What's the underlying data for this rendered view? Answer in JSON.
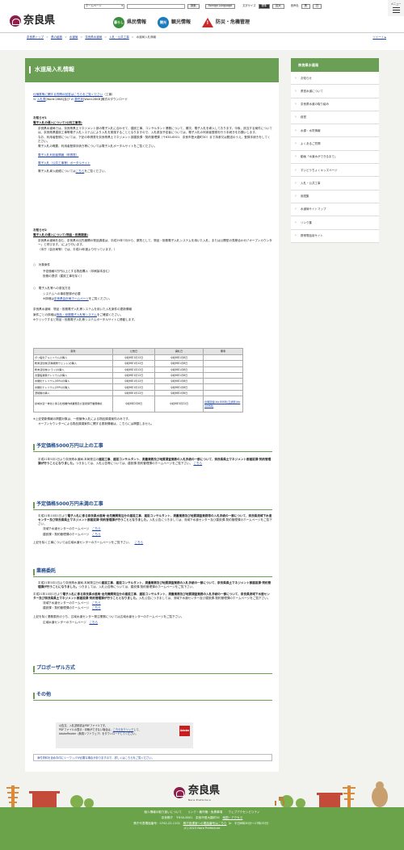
{
  "util": {
    "select": "ホームページ",
    "search": "検索",
    "foreign": "Foreign Language",
    "textsize": "文字サイズ",
    "std": "標準",
    "large": "拡大",
    "voice": "音声色",
    "black": "黒",
    "white": "白",
    "menu": "メニュー"
  },
  "logo": {
    "text": "奈良県"
  },
  "nav": {
    "kurashi": "県民情報",
    "kanko": "観光情報",
    "bosai": "防災・危機管理",
    "kurashi_icon": "暮らし",
    "kanko_icon": "観光"
  },
  "breadcrumbs": [
    "奈良県トップ",
    "県の組織",
    "水道局",
    "奈良県水道局",
    "入札・公共工事",
    "水道局入札情報"
  ],
  "tweet": "ツイート",
  "page": {
    "title": "水道局入札情報"
  },
  "intro": {
    "l1": "仕様書等に関する質問の回答はこちらをご覧ください",
    "l1b": "（工事）",
    "l2a": "入札書",
    "l2b": "[Word:28KB]及び",
    "l2c": "委任状",
    "l2d": "[Word:28KB]様式のダウンロード"
  },
  "notice1": {
    "label": "お知らせ1",
    "head": "電子入札の導入について(公共工事等)",
    "p1": "奈良県水道局では、奈良県県土マネジメント部の電子入札に合わせて、建設工事、コンサルタント業務について、順次、電子入札を導入しております。今後、該当する案件については、奈良県県建設工事等電子入札システムにより入札を実施することとなりますので、入札参加予定者については、電子入札の利用者登録を行う手続きをお願いします。",
    "p2": "なお、利用者登録については、下記の申請書を奈良県県土マネジメント部建設課・契約管理課（〒630-8501　奈良市登大路町30）まで持参又は郵送のうえ、登録手続きをしてください。",
    "p3": "電子入札の概要、利用者登録手続き等については電子入札ポータルサイトをご覧ください。",
    "link1": "電子入札利用者情報（申請書）",
    "link2": "電子入札（公共工事等）ポータルサイト",
    "p4a": "電子入札導入経緯については",
    "p4b": "こちら",
    "p4c": "をご覧ください。"
  },
  "notice2": {
    "label": "お知らせ2",
    "head": "電子入札の導入について(物品・役務調達)",
    "p1": "奈良県水道局を含む、奈良県の出先機関の物品調達は、平成25年7月から、原則として、物品・役務電子入札システムを用いた入札、または公開型の見積合わせ(「オープンカウンター」と呼びます。)により行います。",
    "p2": "（本庁（会計局等）では、平成24年度より行っています。）",
    "t1": "○　対象案件",
    "t1a": "予定価格5万円以上とする物品購入（印刷製本含む）",
    "t1b": "役務の提供（建設工事を除く）",
    "t2": "○　電子入札等への参加方法",
    "t2a": "システムへの事前登録が必要",
    "t2b": "※詳細は",
    "t2c": "奈良県会計局ホームページ",
    "t2d": "をご覧ください。",
    "r1": "奈良県水道局　物品・役務電子入札等システムを用いた入札案件の更新情報",
    "r2a": "案件ごとの詳細は",
    "r2b": "物品・役務電子入札等システム",
    "r2c": "をご確認ください。",
    "r3": "※クリックすると物品・役務電子入札等システムポータルサイトに移動します。",
    "after1": "※上記更新情報の掲載対象は、一般競争入札による物品調達案件のみです。",
    "after2": "オープンカウンターによる物品調達案件に関する更新情報は、こちらには掲載しません。"
  },
  "table": {
    "headers": [
      "案件",
      "公告日",
      "開札日",
      "備考"
    ],
    "rows": [
      [
        "ポリ塩化アルミニウムの購入",
        "令和6年1月12日",
        "令和6年1月8日",
        ""
      ],
      [
        "粉末活性炭(高精能粉ウェット)の購入",
        "令和6年1月12日",
        "令和6年1月8日",
        ""
      ],
      [
        "粉末活性炭(ドライ)の購入",
        "令和6年1月12日",
        "令和6年1月8日",
        ""
      ],
      [
        "次亜塩素酸ナトリウムの購入",
        "令和6年1月12日",
        "令和6年1月8日",
        ""
      ],
      [
        "水酸化ナトリウム(45%)の購入",
        "令和6年1月12日",
        "令和6年1月8日",
        ""
      ],
      [
        "水酸化ナトリウム(20%)の購入",
        "令和6年1月12日",
        "令和6年1月8日",
        ""
      ],
      [
        "濃硫酸の購入",
        "令和6年1月12日",
        "令和6年1月8日",
        ""
      ],
      [
        "県域水道一体化に係る仕様書作成業務及び運用保守業務委託",
        "令和6年2月6日",
        "令和6年3月22日",
        "質問回答(zip 80KB)/正誤表(zip 509KB)"
      ]
    ]
  },
  "sec1": {
    "title": "予定価格5000万円以上の工事",
    "p1a": "平成21年5月1日より奈良県水道局-本局発注の",
    "p1b": "建設工事、建設コンサルタント、測量業務及び地質調査業務の入札手続の一部について、奈良県県土マネジメント部建設課-契約管理課が行うことになりました。",
    "p1c": "つきましては、入札公告等については、建設課-契約管理課のホームページをご覧下さい。",
    "l": "こちら"
  },
  "sec2": {
    "title": "予定価格5000万円未満の工事",
    "p1a": "平成21年10月1日より",
    "p1b": "電子入札に係る奈良県水道局-出先機関発注分の建設工事、建設コンサルタント、測量業務及び地質調査業務等の入札手続の一部について、奈良県流域下水道センター及び奈良県県土マネジメント部建設課-契約管理課が行うこととなりました。",
    "p1c": "入札公告につきましては、流域下水道センター及び建設課-契約管理課のホームページをご覧下さい。",
    "c1": "流域下水道センターのホームページ",
    "c2": "建設課・契約管理課のホームページ",
    "l": "こちら",
    "p2": "上記を除く工事については広域水道センターのホームページをご覧下さい。"
  },
  "sec3": {
    "title": "業務委託",
    "p1a": "平成21年5月1日より奈良県水道局-本局発注分の",
    "p1b": "建設工事、建設コンサルタント、測量業務及び地質調査業務の入札手続の一部について、奈良県県土マネジメント部建設課-契約管理課が行うことになりました。",
    "p1c": "つきましては、入札公告等については、建設課-契約管理課のホームページをご覧下さい。",
    "p2a": "平成21年10月1日より",
    "p2b": "電子入札に係る奈良県水道局-出先機関発注分の建設工事、建設コンサルタント、測量業務及び地質調査業務の入札手続の一部について、奈良県流域下水道センター及び奈良県県土マネジメント部建設課-契約管理課が行うこととなりました。",
    "p2c": "入札公告につきましては、流域下水道センター及び建設課-契約管理課のホームページをご覧下さい。",
    "c1": "流域下水道センターのホームページ",
    "c2": "建設課・契約管理課のホームページ",
    "l": "こちら",
    "p3": "上記を除く業務委託のうち、広域水道センター発注業務については広域水道センターのホームページをご覧下さい。",
    "c3": "広域水道センターのホームページ"
  },
  "sec4": {
    "title": "プロポーザル方式"
  },
  "sec5": {
    "title": "その他"
  },
  "note": {
    "l1": "公告文、入札説明書はPDFファイルです。",
    "l2a": "PDFファイルの表示・印刷ができない場合は、",
    "l2b": "こちらをクリック",
    "l2c": "して、",
    "l3": "AdobeReader（無償ソフトウェア）をダウンロードしてください。",
    "adobe": "Adobe"
  },
  "bottomlink": "添付資料を含めお印にシーワッパが必要な場合がありますので、詳しくはこちらをご覧ください。",
  "side": {
    "head": "奈良県水道局",
    "items": [
      "お知らせ",
      "県営水道について",
      "奈良県水道の取り組み",
      "経営",
      "水源・水質情報",
      "よくあるご質問",
      "動画「水道水ができるまで」",
      "すいどうちょくキッズページ",
      "入札・公共工事",
      "用語集",
      "水道局サイトマップ",
      "リンク集",
      "携帯電話用サイト"
    ]
  },
  "footer": {
    "logo": "奈良県",
    "sub": "Nara Prefecture",
    "links": "個人情報の取り扱いについて　　リンク・著作権・免責事項　　ウェブアクセシビリティ",
    "addr1": "奈良県庁　〒630-8501　奈良市登大路町30　",
    "access": "地図・アクセス",
    "tel": "県庁代表電話番号：0742-22-1101　",
    "tel2": "県庁各課室への電話番号はこちら",
    "hours": "（b　平日8時30分〜17時15分）",
    "copy": "(C) 2023 Nara Prefecture"
  }
}
